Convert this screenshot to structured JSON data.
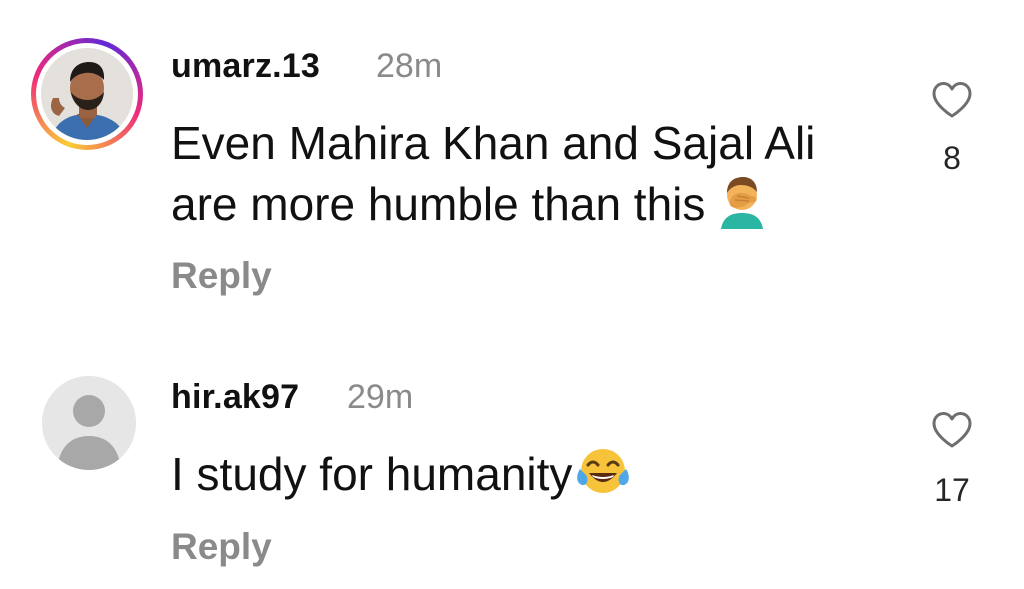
{
  "comments": [
    {
      "username": "umarz.13",
      "time": "28m",
      "text_lines": [
        "Even Mahira Khan and Sajal Ali",
        "are more humble than this"
      ],
      "emoji": "man-facepalming-emoji",
      "reply_label": "Reply",
      "likes": "8",
      "avatar": "profile-photo",
      "has_story_ring": true
    },
    {
      "username": "hir.ak97",
      "time": "29m",
      "text_lines": [
        "I study for humanity"
      ],
      "emoji": "face-with-tears-of-joy-emoji",
      "reply_label": "Reply",
      "likes": "17",
      "avatar": "default-avatar",
      "has_story_ring": false
    }
  ],
  "icons": {
    "like": "heart-outline-icon"
  },
  "colors": {
    "text_primary": "#111111",
    "text_secondary": "#8a8a8a",
    "story_ring_start": "#f9ce34",
    "story_ring_mid": "#ee2a7b",
    "story_ring_end": "#6228d7",
    "default_avatar_bg": "#e6e6e6",
    "default_avatar_fg": "#a8a8a8"
  }
}
